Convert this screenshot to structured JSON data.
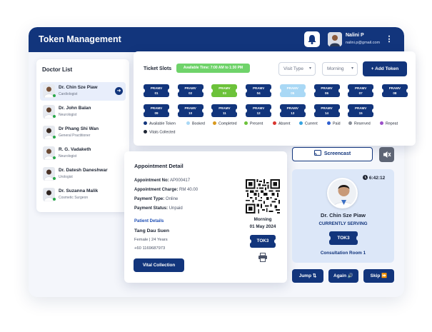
{
  "app": {
    "title": "Token Management"
  },
  "user": {
    "name": "Nalini P",
    "email": "nalini.p@gmail.com"
  },
  "doctor_list": {
    "title": "Doctor List",
    "items": [
      {
        "name": "Dr. Chin Sze Piaw",
        "specialty": "Cardiologist",
        "active": true
      },
      {
        "name": "Dr. John Balan",
        "specialty": "Neurologist"
      },
      {
        "name": "Dr Phang Shi Wan",
        "specialty": "General Practitioner"
      },
      {
        "name": "R. G. Vadaketh",
        "specialty": "Neurologist"
      },
      {
        "name": "Dr. Datesh Daneshwar",
        "specialty": "Urologist"
      },
      {
        "name": "Dr. Suzanna Malik",
        "specialty": "Cosmetic Surgeon"
      }
    ]
  },
  "ticket_slots": {
    "title": "Ticket Slots",
    "available_time": "Available Time: 7:00 AM to 1:30 PM",
    "visit_type_placeholder": "Visit Type",
    "session": "Morning",
    "add_token_label": "+ Add Token",
    "tickets": [
      {
        "prefix": "PRAMV",
        "num": "01",
        "status": "available"
      },
      {
        "prefix": "PRAMV",
        "num": "02",
        "status": "available"
      },
      {
        "prefix": "PRAMV",
        "num": "03",
        "status": "present"
      },
      {
        "prefix": "PRAMV",
        "num": "04",
        "status": "available"
      },
      {
        "prefix": "PRAMV",
        "num": "05",
        "status": "booked"
      },
      {
        "prefix": "PRAMV",
        "num": "06",
        "status": "available"
      },
      {
        "prefix": "PRAMV",
        "num": "07",
        "status": "available"
      },
      {
        "prefix": "PRAMV",
        "num": "08",
        "status": "available"
      },
      {
        "prefix": "PRAMV",
        "num": "09",
        "status": "available"
      },
      {
        "prefix": "PRAMV",
        "num": "10",
        "status": "available"
      },
      {
        "prefix": "PRAMV",
        "num": "11",
        "status": "available"
      },
      {
        "prefix": "PRAMV",
        "num": "12",
        "status": "available"
      },
      {
        "prefix": "PRAMV",
        "num": "13",
        "status": "available"
      },
      {
        "prefix": "PRAMV",
        "num": "14",
        "status": "available"
      },
      {
        "prefix": "PRAMV",
        "num": "15",
        "status": "available"
      }
    ],
    "legend": [
      {
        "label": "Available Token",
        "color": "#12357c"
      },
      {
        "label": "Booked",
        "color": "#a9d8f5"
      },
      {
        "label": "Completed",
        "color": "#d99a1e"
      },
      {
        "label": "Present",
        "color": "#6cc23a"
      },
      {
        "label": "Absent",
        "color": "#d9352f"
      },
      {
        "label": "Current",
        "color": "#36a3e0"
      },
      {
        "label": "Paid",
        "color": "#2f5fd0"
      },
      {
        "label": "Reserved",
        "color": "#8a8f99"
      },
      {
        "label": "Repeat",
        "color": "#9b4fc9"
      },
      {
        "label": "Vitals Collected",
        "color": "#1d2433"
      }
    ]
  },
  "appointment": {
    "title": "Appointment Detail",
    "no_label": "Appointment No:",
    "no_value": "AP000417",
    "charge_label": "Appointment Charge:",
    "charge_value": "RM 40.00",
    "payment_type_label": "Payment Type:",
    "payment_type_value": "Online",
    "payment_status_label": "Payment Status:",
    "payment_status_value": "Unpaid",
    "patient_heading": "Patient Details",
    "patient_name": "Tang Dau Suen",
    "patient_gender_age": "Female | 24 Years",
    "patient_phone": "+60 1169687973",
    "vital_button": "Vital Collection",
    "session": "Morning",
    "date": "01 May 2024",
    "ticket": "TOK3"
  },
  "serving": {
    "screencast_label": "Screencast",
    "time": "6:42:12",
    "doctor": "Dr. Chin Sze Piaw",
    "status": "CURRENTLY SERVING",
    "ticket": "TOK3",
    "room": "Consultation Room 1",
    "jump_label": "Jump ⇅",
    "again_label": "Again 🔊",
    "skip_label": "Skip ⏩"
  }
}
